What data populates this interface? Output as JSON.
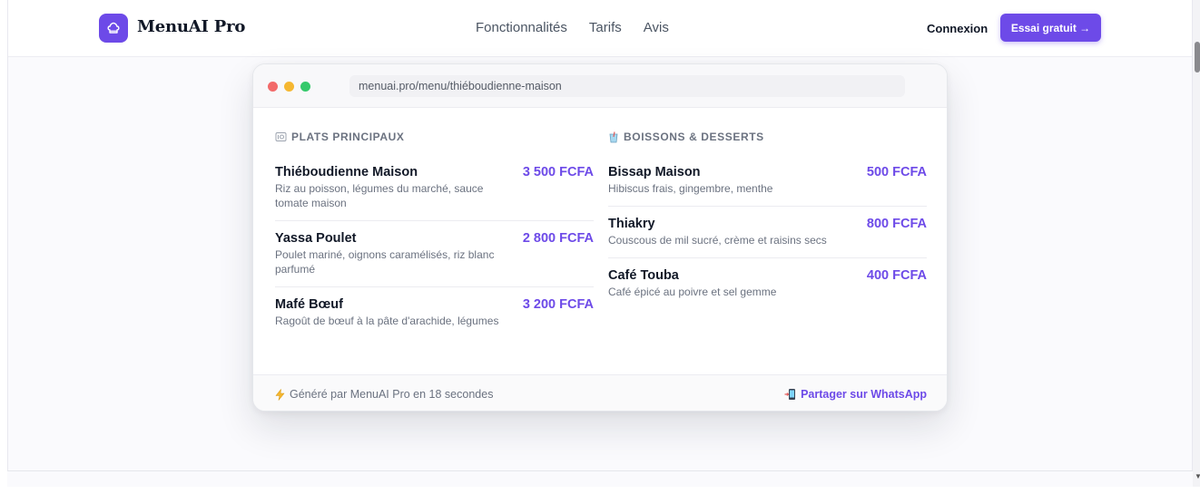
{
  "nav": {
    "brand": "MenuAI Pro",
    "links": [
      "Fonctionnalités",
      "Tarifs",
      "Avis"
    ],
    "login": "Connexion",
    "cta": "Essai gratuit →"
  },
  "card": {
    "url": "menuai.pro/menu/thiéboudienne-maison",
    "left_section": {
      "title": "PLATS PRINCIPAUX",
      "items": [
        {
          "name": "Thiéboudienne Maison",
          "price": "3 500 FCFA",
          "desc": "Riz au poisson, légumes du marché, sauce tomate maison"
        },
        {
          "name": "Yassa Poulet",
          "price": "2 800 FCFA",
          "desc": "Poulet mariné, oignons caramélisés, riz blanc parfumé"
        },
        {
          "name": "Mafé Bœuf",
          "price": "3 200 FCFA",
          "desc": "Ragoût de bœuf à la pâte d'arachide, légumes"
        }
      ]
    },
    "right_section": {
      "title": "BOISSONS & DESSERTS",
      "items": [
        {
          "name": "Bissap Maison",
          "price": "500 FCFA",
          "desc": "Hibiscus frais, gingembre, menthe"
        },
        {
          "name": "Thiakry",
          "price": "800 FCFA",
          "desc": "Couscous de mil sucré, crème et raisins secs"
        },
        {
          "name": "Café Touba",
          "price": "400 FCFA",
          "desc": "Café épicé au poivre et sel gemme"
        }
      ]
    },
    "footer": {
      "generated": "Généré par MenuAI Pro en 18 secondes",
      "share": "Partager sur WhatsApp"
    }
  },
  "colors": {
    "accent": "#6d4ae8"
  },
  "icons": {
    "logo": "chef-hat-icon",
    "plates": "plate-icon",
    "drinks": "cup-icon",
    "generated": "lightning-icon",
    "share": "phone-icon"
  }
}
